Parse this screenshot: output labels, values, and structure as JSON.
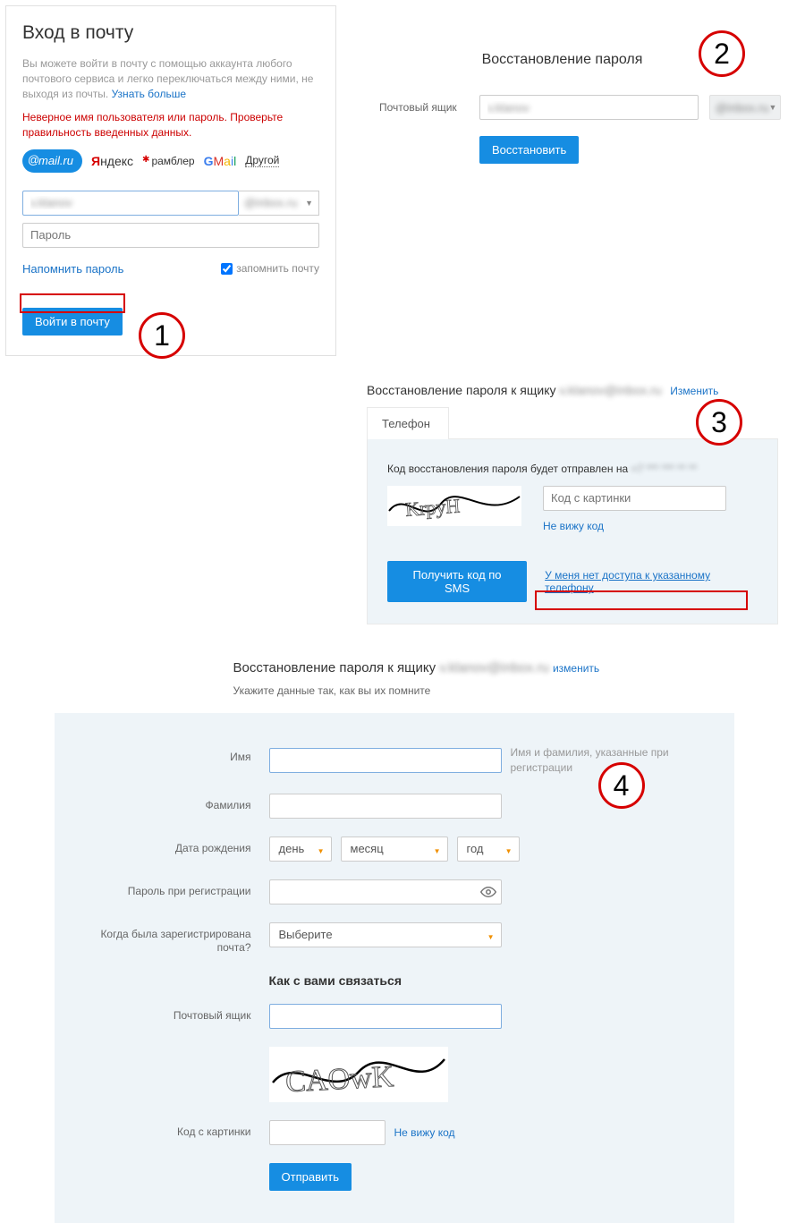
{
  "annotations": {
    "n1": "1",
    "n2": "2",
    "n3": "3",
    "n4": "4"
  },
  "login": {
    "title": "Вход в почту",
    "intro": "Вы можете войти в почту с помощью аккаунта любого почтового сервиса и легко переключаться между ними, не выходя из почты.",
    "learn_more": "Узнать больше",
    "error": "Неверное имя пользователя или пароль. Проверьте правильность введенных данных.",
    "providers": {
      "mailru": "mail.ru",
      "yandex": "ндекс",
      "yandex_first": "Я",
      "rambler": "рамблер",
      "gmail_parts": {
        "g": "G",
        "m": "M",
        "a": "a",
        "i": "i",
        "l": "l"
      },
      "other": "Другой"
    },
    "username_value": "v.klanov",
    "domain_value": "@inbox.ru",
    "password_placeholder": "Пароль",
    "remind_link": "Напомнить пароль",
    "remember_label": "запомнить почту",
    "submit": "Войти в почту"
  },
  "recovery": {
    "title": "Восстановление пароля",
    "email_label": "Почтовый ящик",
    "email_value": "v.klanov",
    "domain_value": "@inbox.ru",
    "submit": "Восстановить"
  },
  "phone": {
    "header_prefix": "Восстановление пароля к ящику",
    "header_email": "v.klanov@inbox.ru",
    "change_link": "Изменить",
    "tab_label": "Телефон",
    "msg_prefix": "Код восстановления пароля будет отправлен на",
    "msg_number": "+7 *** *** ** **",
    "captcha_placeholder": "Код с картинки",
    "cant_see": "Не вижу код",
    "sms_btn": "Получить код по SMS",
    "no_access": "У меня нет доступа к указанному телефону"
  },
  "full": {
    "header_prefix": "Восстановление пароля к ящику",
    "header_email": "v.klanov@inbox.ru",
    "change_link": "изменить",
    "subtitle": "Укажите данные так, как вы их помните",
    "name_label": "Имя",
    "name_hint": "Имя и фамилия, указанные при регистрации",
    "surname_label": "Фамилия",
    "dob_label": "Дата рождения",
    "day": "день",
    "month": "месяц",
    "year": "год",
    "password_label": "Пароль при регистрации",
    "when_label": "Когда была зарегистрирована почта?",
    "when_value": "Выберите",
    "contact_heading": "Как с вами связаться",
    "contact_label": "Почтовый ящик",
    "code_label": "Код с картинки",
    "cant_see": "Не вижу код",
    "submit": "Отправить"
  }
}
